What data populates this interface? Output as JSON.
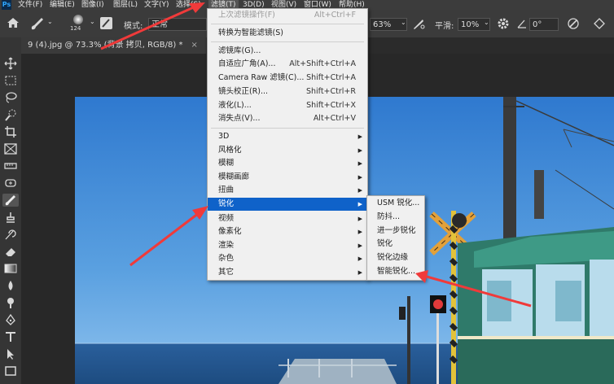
{
  "app": {
    "logo_text": "Ps"
  },
  "menubar": {
    "items": [
      {
        "label": "文件(F)"
      },
      {
        "label": "编辑(E)"
      },
      {
        "label": "图像(I)"
      },
      {
        "label": "图层(L)"
      },
      {
        "label": "文字(Y)"
      },
      {
        "label": "选择(S)"
      },
      {
        "label": "滤镜(T)"
      },
      {
        "label": "3D(D)"
      },
      {
        "label": "视图(V)"
      },
      {
        "label": "窗口(W)"
      },
      {
        "label": "帮助(H)"
      }
    ]
  },
  "options_bar": {
    "brush_size": "124",
    "mode_label": "模式:",
    "mode_value": "正常",
    "flow_value": "63%",
    "smoothing_label": "平滑:",
    "smoothing_value": "10%",
    "angle_value": "0°"
  },
  "document_tab": {
    "title": "9 (4).jpg @ 73.3% (背景 拷贝, RGB/8) *",
    "close_glyph": "×"
  },
  "filter_menu": {
    "items": [
      {
        "label": "上次滤镜操作(F)",
        "shortcut": "Alt+Ctrl+F",
        "disabled": true
      },
      {
        "label": "转换为智能滤镜(S)",
        "shortcut": ""
      },
      {
        "label": "滤镜库(G)...",
        "shortcut": ""
      },
      {
        "label": "自适应广角(A)...",
        "shortcut": "Alt+Shift+Ctrl+A"
      },
      {
        "label": "Camera Raw 滤镜(C)...",
        "shortcut": "Shift+Ctrl+A"
      },
      {
        "label": "镜头校正(R)...",
        "shortcut": "Shift+Ctrl+R"
      },
      {
        "label": "液化(L)...",
        "shortcut": "Shift+Ctrl+X"
      },
      {
        "label": "消失点(V)...",
        "shortcut": "Alt+Ctrl+V"
      },
      {
        "label": "3D",
        "submenu": true
      },
      {
        "label": "风格化",
        "submenu": true
      },
      {
        "label": "模糊",
        "submenu": true
      },
      {
        "label": "模糊画廊",
        "submenu": true
      },
      {
        "label": "扭曲",
        "submenu": true
      },
      {
        "label": "锐化",
        "submenu": true,
        "highlighted": true
      },
      {
        "label": "视频",
        "submenu": true
      },
      {
        "label": "像素化",
        "submenu": true
      },
      {
        "label": "渲染",
        "submenu": true
      },
      {
        "label": "杂色",
        "submenu": true
      },
      {
        "label": "其它",
        "submenu": true
      }
    ],
    "submenu_arrow": "▶"
  },
  "sharpen_submenu": {
    "items": [
      {
        "label": "USM 锐化..."
      },
      {
        "label": "防抖..."
      },
      {
        "label": "进一步锐化"
      },
      {
        "label": "锐化"
      },
      {
        "label": "锐化边缘"
      },
      {
        "label": "智能锐化..."
      }
    ]
  },
  "colors": {
    "menu_highlight": "#0f62c9",
    "annotation_arrow": "#f03a3a",
    "photo_sky": "#4a8fd8",
    "train_teal": "#2f7a6a"
  }
}
